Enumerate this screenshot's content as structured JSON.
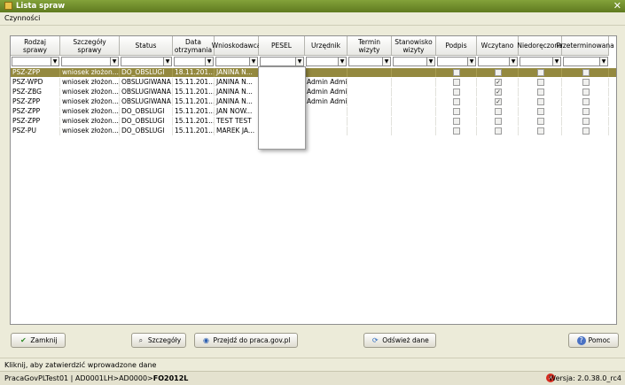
{
  "window": {
    "title": "Lista spraw"
  },
  "menu": {
    "label": "Czynności"
  },
  "columns": [
    {
      "label": "Rodzaj sprawy"
    },
    {
      "label": "Szczegóły sprawy"
    },
    {
      "label": "Status"
    },
    {
      "label": "Data otrzymania"
    },
    {
      "label": "Wnioskodawca"
    },
    {
      "label": "PESEL"
    },
    {
      "label": "Urzędnik"
    },
    {
      "label": "Termin wizyty"
    },
    {
      "label": "Stanowisko wizyty"
    },
    {
      "label": "Podpis"
    },
    {
      "label": "Wczytano"
    },
    {
      "label": "Niedoręczona"
    },
    {
      "label": "Przeterminowana"
    }
  ],
  "rows": [
    {
      "rodzaj": "PSZ-ZPP",
      "szczegoly": "wniosek złożon...",
      "status": "DO_OBSLUGI",
      "data": "18.11.201...",
      "wnioskodawca": "JANINA N...",
      "urzednik": "",
      "podpis": false,
      "wczytano": false,
      "niedoreczona": false,
      "przeterminowana": false
    },
    {
      "rodzaj": "PSZ-WPD",
      "szczegoly": "wniosek złożon...",
      "status": "OBSLUGIWANA",
      "data": "15.11.201...",
      "wnioskodawca": "JANINA N...",
      "urzednik": "Admin Admin",
      "podpis": false,
      "wczytano": true,
      "niedoreczona": false,
      "przeterminowana": false
    },
    {
      "rodzaj": "PSZ-ZBG",
      "szczegoly": "wniosek złożon...",
      "status": "OBSLUGIWANA",
      "data": "15.11.201...",
      "wnioskodawca": "JANINA N...",
      "urzednik": "Admin Admin",
      "podpis": false,
      "wczytano": true,
      "niedoreczona": false,
      "przeterminowana": false
    },
    {
      "rodzaj": "PSZ-ZPP",
      "szczegoly": "wniosek złożon...",
      "status": "OBSLUGIWANA",
      "data": "15.11.201...",
      "wnioskodawca": "JANINA N...",
      "urzednik": "Admin Admin",
      "podpis": false,
      "wczytano": true,
      "niedoreczona": false,
      "przeterminowana": false
    },
    {
      "rodzaj": "PSZ-ZPP",
      "szczegoly": "wniosek złożon...",
      "status": "DO_OBSLUGI",
      "data": "15.11.201...",
      "wnioskodawca": "JAN NOW...",
      "urzednik": "",
      "podpis": false,
      "wczytano": false,
      "niedoreczona": false,
      "przeterminowana": false
    },
    {
      "rodzaj": "PSZ-ZPP",
      "szczegoly": "wniosek złożon...",
      "status": "DO_OBSLUGI",
      "data": "15.11.201...",
      "wnioskodawca": "TEST TEST",
      "urzednik": "",
      "podpis": false,
      "wczytano": false,
      "niedoreczona": false,
      "przeterminowana": false
    },
    {
      "rodzaj": "PSZ-PU",
      "szczegoly": "wniosek złożon...",
      "status": "DO_OBSLUGI",
      "data": "15.11.201...",
      "wnioskodawca": "MAREK JA...",
      "urzednik": "",
      "podpis": false,
      "wczytano": false,
      "niedoreczona": false,
      "przeterminowana": false
    }
  ],
  "buttons": {
    "zamknij": "Zamknij",
    "szczegoly": "Szczegóły",
    "przejdz": "Przejdź do praca.gov.pl",
    "odswiez": "Odśwież dane",
    "pomoc": "Pomoc"
  },
  "status": {
    "hint": "Kliknij, aby zatwierdzić wprowadzone dane",
    "path_prefix": "PracaGovPLTest01 | AD0001LH>AD0000>",
    "path_bold": "FO2012L",
    "version": "Wersja: 2.0.38.0_rc4"
  },
  "colors": {
    "titlebar": "#6e8c2a",
    "selected_row": "#94893f"
  }
}
